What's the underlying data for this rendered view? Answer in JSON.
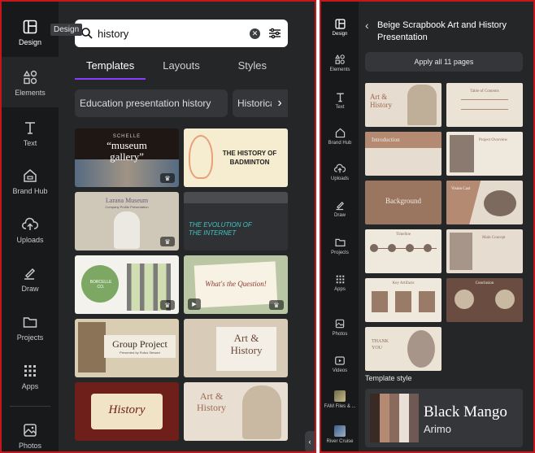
{
  "left_panel": {
    "rail": [
      {
        "label": "Design",
        "icon": "layout-icon"
      },
      {
        "label": "Elements",
        "icon": "shapes-icon"
      },
      {
        "label": "Text",
        "icon": "text-icon"
      },
      {
        "label": "Brand Hub",
        "icon": "brand-hub-icon"
      },
      {
        "label": "Uploads",
        "icon": "cloud-upload-icon"
      },
      {
        "label": "Draw",
        "icon": "pen-icon"
      },
      {
        "label": "Projects",
        "icon": "folder-icon"
      },
      {
        "label": "Apps",
        "icon": "apps-grid-icon"
      },
      {
        "label": "Photos",
        "icon": "image-icon"
      }
    ],
    "tooltip": "Design",
    "search": {
      "value": "history"
    },
    "tabs": [
      "Templates",
      "Layouts",
      "Styles"
    ],
    "chips": [
      "Education presentation history",
      "Historica"
    ],
    "templates": [
      {
        "lines": [
          "SCHELLE",
          "“museum",
          "gallery”"
        ]
      },
      {
        "lines": [
          "THE HISTORY OF",
          "BADMINTON"
        ]
      },
      {
        "lines": [
          "Larana Museum",
          "Company Profile Presentation"
        ]
      },
      {
        "lines": [
          "THE EVOLUTION OF",
          "THE INTERNET"
        ]
      },
      {
        "lines": [
          "BORCELLE CO."
        ]
      },
      {
        "lines": [
          "What's the Question!"
        ]
      },
      {
        "lines": [
          "Group Project",
          "Presented by Rufus Stewart"
        ]
      },
      {
        "lines": [
          "Art &",
          "History"
        ]
      },
      {
        "lines": [
          "History"
        ]
      },
      {
        "lines": [
          "Art &",
          "History"
        ]
      }
    ]
  },
  "right_panel": {
    "rail": [
      {
        "label": "Design",
        "icon": "layout-icon"
      },
      {
        "label": "Elements",
        "icon": "shapes-icon"
      },
      {
        "label": "Text",
        "icon": "text-icon"
      },
      {
        "label": "Brand Hub",
        "icon": "brand-hub-icon"
      },
      {
        "label": "Uploads",
        "icon": "cloud-upload-icon"
      },
      {
        "label": "Draw",
        "icon": "pen-icon"
      },
      {
        "label": "Projects",
        "icon": "folder-icon"
      },
      {
        "label": "Apps",
        "icon": "apps-grid-icon"
      },
      {
        "label": "Photos",
        "icon": "image-icon"
      },
      {
        "label": "Videos",
        "icon": "video-icon"
      },
      {
        "label": "FAM Files & ...",
        "icon": "app-thumbnail"
      },
      {
        "label": "River Cruise",
        "icon": "app-thumbnail"
      }
    ],
    "title": "Beige Scrapbook Art and History Presentation",
    "apply_button": "Apply all 11 pages",
    "pages": [
      {
        "title": "Art & History"
      },
      {
        "title": "Table of Contents"
      },
      {
        "title": "Introduction"
      },
      {
        "title": "Project Overview"
      },
      {
        "title": "Background"
      },
      {
        "title": "Vision Cast"
      },
      {
        "title": "Timeline"
      },
      {
        "title": "Main Concept"
      },
      {
        "title": "Key Artifacts"
      },
      {
        "title": "Conclusion"
      },
      {
        "title": "THANK YOU"
      }
    ],
    "template_style_label": "Template style",
    "style_fonts": {
      "heading": "Black Mango",
      "body": "Arimo"
    },
    "style_colors": [
      "#3a2a24",
      "#b48a73",
      "#8a6a5c",
      "#e9e1d8",
      "#6e5a52"
    ]
  }
}
